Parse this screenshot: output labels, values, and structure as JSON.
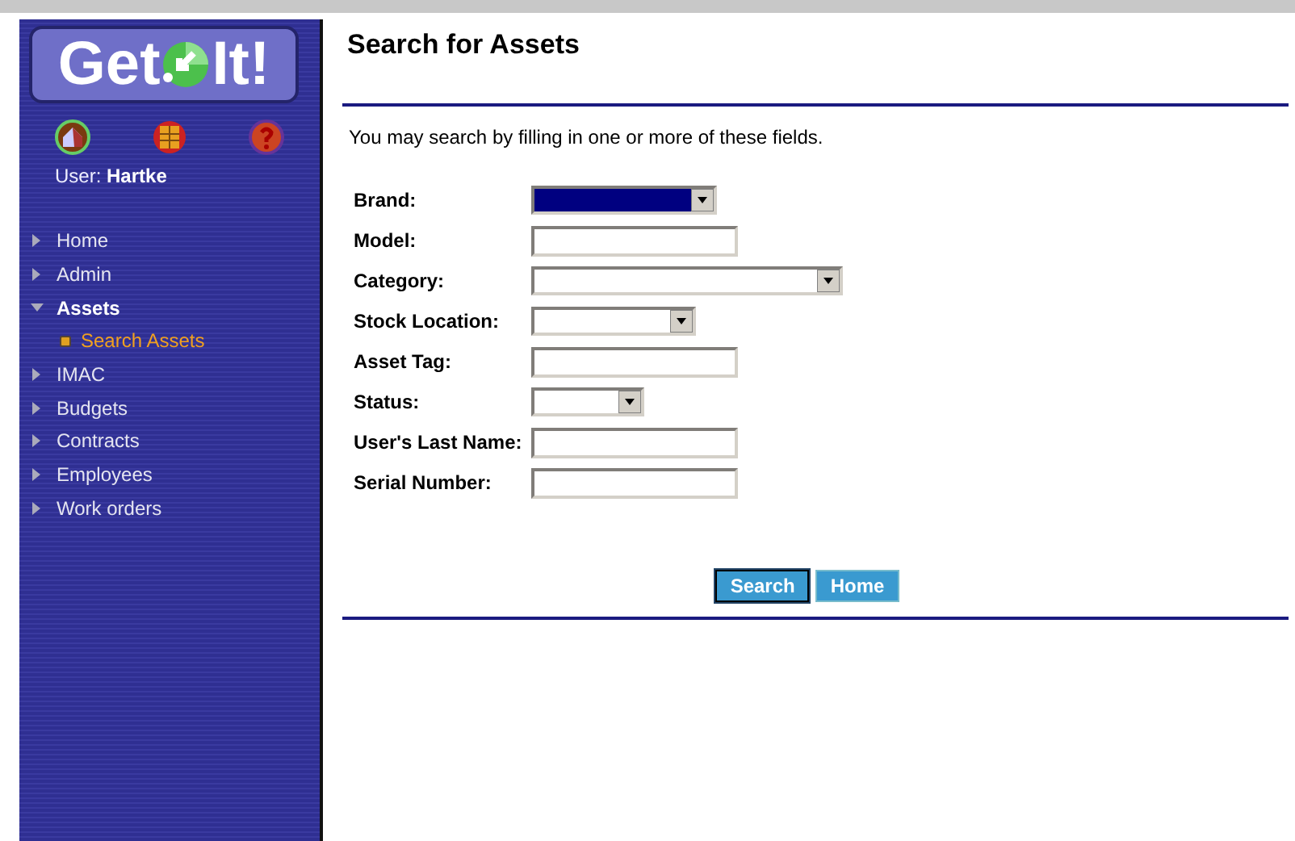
{
  "logo": {
    "left": "Get",
    "right": "It!"
  },
  "user": {
    "label": "User:",
    "name": "Hartke"
  },
  "nav": [
    {
      "label": "Home",
      "expanded": false
    },
    {
      "label": "Admin",
      "expanded": false
    },
    {
      "label": "Assets",
      "expanded": true,
      "children": [
        {
          "label": "Search Assets",
          "selected": true
        }
      ]
    },
    {
      "label": "IMAC",
      "expanded": false
    },
    {
      "label": "Budgets",
      "expanded": false
    },
    {
      "label": "Contracts",
      "expanded": false
    },
    {
      "label": "Employees",
      "expanded": false
    },
    {
      "label": "Work orders",
      "expanded": false
    }
  ],
  "title": "Search for Assets",
  "intro": "You may search by filling in one or more of these fields.",
  "fields": [
    {
      "label": "Brand:",
      "kind": "select",
      "focused": true
    },
    {
      "label": "Model:",
      "kind": "text"
    },
    {
      "label": "Category:",
      "kind": "select",
      "focused": false
    },
    {
      "label": "Stock Location:",
      "kind": "select",
      "focused": false
    },
    {
      "label": "Asset Tag:",
      "kind": "text"
    },
    {
      "label": "Status:",
      "kind": "select",
      "focused": false
    },
    {
      "label": "User's Last Name:",
      "kind": "text"
    },
    {
      "label": "Serial Number:",
      "kind": "text"
    }
  ],
  "buttons": [
    {
      "label": "Search",
      "selected": true
    },
    {
      "label": "Home",
      "selected": false
    }
  ]
}
